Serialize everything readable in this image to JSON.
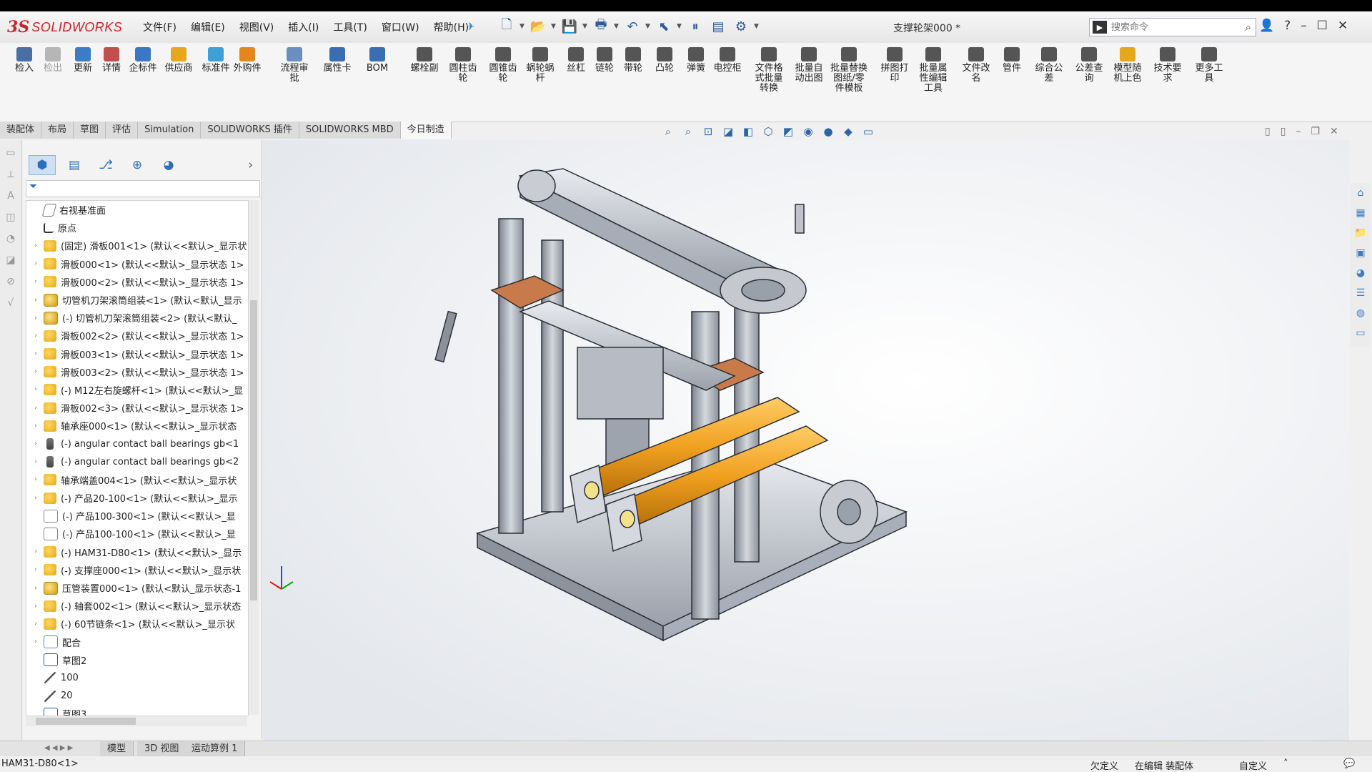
{
  "app": {
    "logo_ds": "3S",
    "logo_name": "SOLIDWORKS",
    "document_title": "支撑轮架000 *",
    "menu": [
      "文件(F)",
      "编辑(E)",
      "视图(V)",
      "插入(I)",
      "工具(T)",
      "窗口(W)",
      "帮助(H)"
    ],
    "search_placeholder": "搜索命令"
  },
  "ribbon": {
    "tools": [
      {
        "label": "检入",
        "disabled": false,
        "color": "#4a6fa5"
      },
      {
        "label": "检出",
        "disabled": true,
        "color": "#b6b6b6"
      },
      {
        "label": "更新",
        "disabled": false,
        "color": "#3c7cc4"
      },
      {
        "label": "详情",
        "disabled": false,
        "color": "#c0504d"
      },
      {
        "label": "企标件",
        "disabled": false,
        "color": "#3a78c3"
      },
      {
        "label": "供应商",
        "disabled": false,
        "color": "#e5a81c"
      },
      {
        "label": "标准件",
        "disabled": false,
        "color": "#3fa0d8"
      },
      {
        "label": "外购件",
        "disabled": false,
        "color": "#e5861c"
      },
      {
        "label": "流程审\n批",
        "disabled": false,
        "color": "#6a8fbf"
      },
      {
        "label": "属性卡",
        "disabled": false,
        "color": "#3a6eb0"
      },
      {
        "label": "BOM",
        "disabled": false,
        "color": "#3a6eb0"
      },
      {
        "label": "螺栓副",
        "disabled": false,
        "color": "#555555"
      },
      {
        "label": "圆柱齿\n轮",
        "disabled": false,
        "color": "#555555"
      },
      {
        "label": "圆锥齿\n轮",
        "disabled": false,
        "color": "#555555"
      },
      {
        "label": "蜗轮蜗\n杆",
        "disabled": false,
        "color": "#555555"
      },
      {
        "label": "丝杠",
        "disabled": false,
        "color": "#555555"
      },
      {
        "label": "链轮",
        "disabled": false,
        "color": "#555555"
      },
      {
        "label": "带轮",
        "disabled": false,
        "color": "#555555"
      },
      {
        "label": "凸轮",
        "disabled": false,
        "color": "#555555"
      },
      {
        "label": "弹簧",
        "disabled": false,
        "color": "#555555"
      },
      {
        "label": "电控柜",
        "disabled": false,
        "color": "#555555"
      },
      {
        "label": "文件格\n式批量\n转换",
        "disabled": false,
        "color": "#555555"
      },
      {
        "label": "批量自\n动出图",
        "disabled": false,
        "color": "#555555"
      },
      {
        "label": "批量替换\n图纸/零\n件模板",
        "disabled": false,
        "color": "#555555"
      },
      {
        "label": "拼图打\n印",
        "disabled": false,
        "color": "#555555"
      },
      {
        "label": "批量属\n性编辑\n工具",
        "disabled": false,
        "color": "#555555"
      },
      {
        "label": "文件改\n名",
        "disabled": false,
        "color": "#555555"
      },
      {
        "label": "管件",
        "disabled": false,
        "color": "#555555"
      },
      {
        "label": "综合公\n差",
        "disabled": false,
        "color": "#555555"
      },
      {
        "label": "公差查\n询",
        "disabled": false,
        "color": "#555555"
      },
      {
        "label": "模型随\n机上色",
        "disabled": false,
        "color": "#e5a81c"
      },
      {
        "label": "技术要\n求",
        "disabled": false,
        "color": "#555555"
      },
      {
        "label": "更多工\n具",
        "disabled": false,
        "color": "#555555"
      }
    ]
  },
  "tabs": [
    {
      "label": "装配体",
      "active": false
    },
    {
      "label": "布局",
      "active": false
    },
    {
      "label": "草图",
      "active": false
    },
    {
      "label": "评估",
      "active": false
    },
    {
      "label": "Simulation",
      "active": false
    },
    {
      "label": "SOLIDWORKS 插件",
      "active": false
    },
    {
      "label": "SOLIDWORKS MBD",
      "active": false
    },
    {
      "label": "今日制造",
      "active": true
    }
  ],
  "tree": {
    "items": [
      {
        "text": "右视基准面",
        "icon": "plane",
        "expand": false
      },
      {
        "text": "原点",
        "icon": "origin",
        "expand": false
      },
      {
        "text": "(固定) 滑板001<1> (默认<<默认>_显示状",
        "icon": "part",
        "expand": true
      },
      {
        "text": "滑板000<1> (默认<<默认>_显示状态 1>",
        "icon": "part",
        "expand": true
      },
      {
        "text": "滑板000<2> (默认<<默认>_显示状态 1>",
        "icon": "part",
        "expand": true
      },
      {
        "text": "切管机刀架滚筒组装<1> (默认<默认_显示",
        "icon": "asm",
        "expand": true
      },
      {
        "text": "(-) 切管机刀架滚筒组装<2> (默认<默认_",
        "icon": "asm",
        "expand": true
      },
      {
        "text": "滑板002<2> (默认<<默认>_显示状态 1>",
        "icon": "part",
        "expand": true
      },
      {
        "text": "滑板003<1> (默认<<默认>_显示状态 1>",
        "icon": "part",
        "expand": true
      },
      {
        "text": "滑板003<2> (默认<<默认>_显示状态 1>",
        "icon": "part",
        "expand": true
      },
      {
        "text": "(-) M12左右旋螺杆<1> (默认<<默认>_显",
        "icon": "part",
        "expand": true
      },
      {
        "text": "滑板002<3> (默认<<默认>_显示状态 1>",
        "icon": "part",
        "expand": true
      },
      {
        "text": "轴承座000<1> (默认<<默认>_显示状态",
        "icon": "part",
        "expand": true
      },
      {
        "text": "(-) angular contact ball bearings gb<1",
        "icon": "bolt",
        "expand": true
      },
      {
        "text": "(-) angular contact ball bearings gb<2",
        "icon": "bolt",
        "expand": true
      },
      {
        "text": "轴承端盖004<1> (默认<<默认>_显示状",
        "icon": "part",
        "expand": true
      },
      {
        "text": "(-) 产品20-100<1> (默认<<默认>_显示",
        "icon": "part",
        "expand": true
      },
      {
        "text": "(-) 产品100-300<1> (默认<<默认>_显",
        "icon": "ghost",
        "expand": false
      },
      {
        "text": "(-) 产品100-100<1> (默认<<默认>_显",
        "icon": "ghost",
        "expand": false
      },
      {
        "text": "(-) HAM31-D80<1> (默认<<默认>_显示",
        "icon": "part",
        "expand": true
      },
      {
        "text": "(-) 支撑座000<1> (默认<<默认>_显示状",
        "icon": "part",
        "expand": true
      },
      {
        "text": "压管装置000<1> (默认<默认_显示状态-1",
        "icon": "asm",
        "expand": true
      },
      {
        "text": "(-) 轴套002<1> (默认<<默认>_显示状态",
        "icon": "part",
        "expand": true
      },
      {
        "text": "(-) 60节链条<1> (默认<<默认>_显示状",
        "icon": "part",
        "expand": true
      },
      {
        "text": "配合",
        "icon": "mate",
        "expand": true
      },
      {
        "text": "草图2",
        "icon": "sketch",
        "expand": false
      },
      {
        "text": "100",
        "icon": "line",
        "expand": false
      },
      {
        "text": "20",
        "icon": "line",
        "expand": false
      },
      {
        "text": "草图3",
        "icon": "sketch",
        "expand": false
      }
    ]
  },
  "bottom_tabs": [
    "模型",
    "3D 视图",
    "运动算例 1"
  ],
  "status": {
    "selection": "HAM31-D80<1>",
    "state1": "欠定义",
    "state2": "在编辑 装配体",
    "state3": "自定义"
  },
  "colors": {
    "brand": "#d0202a",
    "accent": "#2d6fb6",
    "part_orange": "#f0a020",
    "model_steel": "#a9afba"
  }
}
